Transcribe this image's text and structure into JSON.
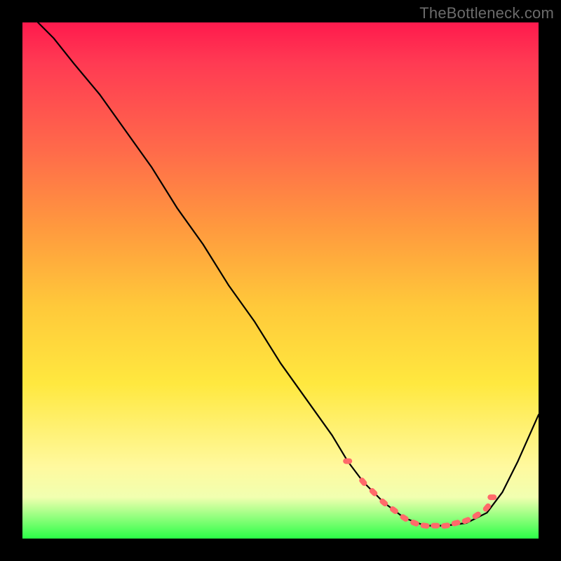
{
  "watermark": "TheBottleneck.com",
  "chart_data": {
    "type": "line",
    "title": "",
    "xlabel": "",
    "ylabel": "",
    "xlim": [
      0,
      100
    ],
    "ylim": [
      0,
      100
    ],
    "grid": false,
    "legend": false,
    "background_gradient": {
      "stops": [
        {
          "pos": 0.0,
          "color": "#ff1a4d"
        },
        {
          "pos": 0.4,
          "color": "#ff9a3e"
        },
        {
          "pos": 0.7,
          "color": "#ffe83f"
        },
        {
          "pos": 0.92,
          "color": "#f1ffb0"
        },
        {
          "pos": 1.0,
          "color": "#2bff47"
        }
      ]
    },
    "series": [
      {
        "name": "bottleneck-curve",
        "color": "#000000",
        "x": [
          3,
          6,
          10,
          15,
          20,
          25,
          30,
          35,
          40,
          45,
          50,
          55,
          60,
          63,
          66,
          70,
          74,
          78,
          82,
          86,
          90,
          93,
          96,
          100
        ],
        "y": [
          100,
          97,
          92,
          86,
          79,
          72,
          64,
          57,
          49,
          42,
          34,
          27,
          20,
          15,
          11,
          7,
          4,
          2.5,
          2.5,
          3,
          5,
          9,
          15,
          24
        ],
        "note": "y is percent height from bottom (0=bottom green, 100=top red). Valley floor ~2.5% between x≈76..84."
      }
    ],
    "markers": {
      "name": "valley-dots",
      "color": "#ff6a6a",
      "style": "rounded-dash",
      "x": [
        63,
        66,
        68,
        70,
        72,
        74,
        76,
        78,
        80,
        82,
        84,
        86,
        88,
        90,
        91
      ],
      "y": [
        15,
        11,
        9,
        7,
        5.5,
        4,
        3,
        2.5,
        2.5,
        2.5,
        3,
        3.5,
        4.5,
        6,
        8
      ]
    }
  }
}
